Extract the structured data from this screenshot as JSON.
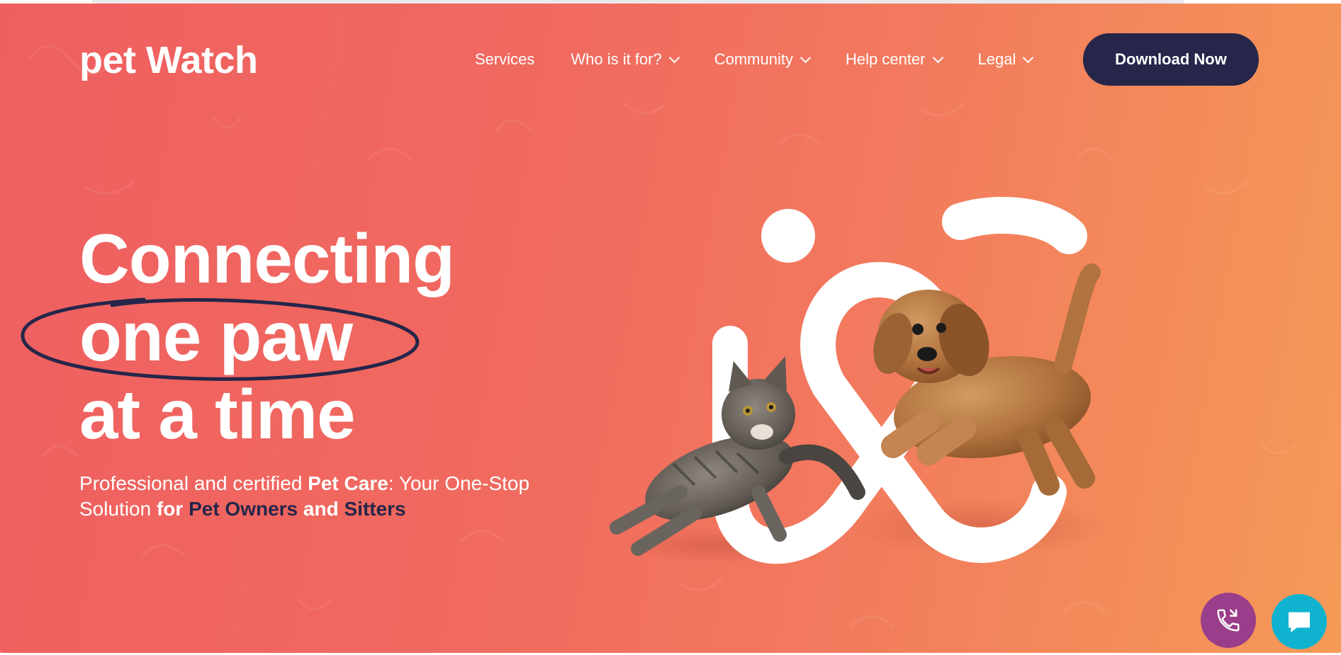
{
  "brand": {
    "logo_text": "pet Watch"
  },
  "nav": {
    "items": [
      {
        "label": "Services",
        "has_dropdown": false
      },
      {
        "label": "Who is it for?",
        "has_dropdown": true
      },
      {
        "label": "Community",
        "has_dropdown": true
      },
      {
        "label": "Help center",
        "has_dropdown": true
      },
      {
        "label": "Legal",
        "has_dropdown": true
      }
    ],
    "cta_label": "Download Now"
  },
  "hero": {
    "headline_line1": "Connecting",
    "headline_line2": "one paw",
    "headline_line3": "at a time",
    "sub_part1": "Professional and certified ",
    "sub_part2": "Pet Care",
    "sub_part3": ": Your One-Stop Solution ",
    "sub_part4": "for",
    "sub_part5": "Pet Owners",
    "sub_part6": "and",
    "sub_part7": "Sitters"
  },
  "floating": {
    "phone_icon": "phone-icon",
    "chat_icon": "chat-icon"
  },
  "colors": {
    "hero_start": "#ef5f60",
    "hero_end": "#f59a57",
    "navy": "#25264a",
    "phone_fab": "#9a3d8a",
    "chat_fab": "#0fb3cf"
  }
}
